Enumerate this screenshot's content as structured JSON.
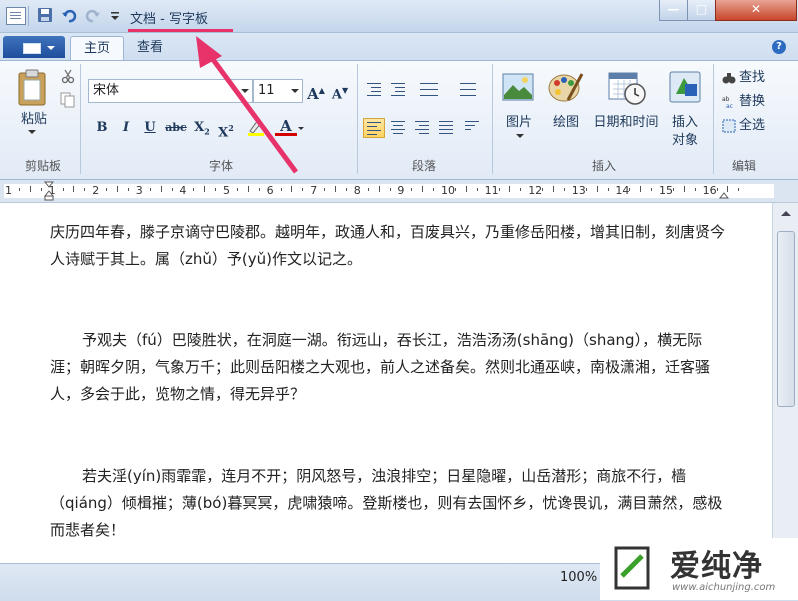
{
  "window": {
    "title": "文档 - 写字板",
    "buttons": {
      "minimize": "—",
      "maximize": "□",
      "close": "✕"
    }
  },
  "quick_access": {
    "save_icon": "save-icon",
    "undo_icon": "undo-icon",
    "redo_icon": "redo-icon",
    "customize_icon": "dropdown-icon"
  },
  "tabs": {
    "home": "主页",
    "view": "查看"
  },
  "ribbon": {
    "clipboard": {
      "paste_label": "粘贴",
      "group_label": "剪贴板"
    },
    "font": {
      "font_name": "宋体",
      "font_size": "11",
      "grow": "A",
      "shrink": "A",
      "bold": "B",
      "italic": "I",
      "underline": "U",
      "strikethrough": "abc",
      "subscript": "X",
      "superscript": "X",
      "highlight": "ab",
      "font_color": "A",
      "group_label": "字体"
    },
    "paragraph": {
      "group_label": "段落"
    },
    "insert": {
      "picture_label": "图片",
      "paint_label": "绘图",
      "datetime_label": "日期和时间",
      "object_label_1": "插入",
      "object_label_2": "对象",
      "group_label": "插入"
    },
    "editing": {
      "find_label": "查找",
      "replace_label": "替换",
      "select_all_label": "全选",
      "group_label": "编辑"
    }
  },
  "ruler": {
    "numbers": [
      "1",
      "1",
      "2",
      "3",
      "4",
      "5",
      "6",
      "7",
      "8",
      "9",
      "10",
      "11",
      "12",
      "13",
      "14",
      "15",
      "16"
    ]
  },
  "document": {
    "paragraphs": [
      "庆历四年春，滕子京谪守巴陵郡。越明年，政通人和，百废具兴，乃重修岳阳楼，增其旧制，刻唐贤今人诗赋于其上。属（zhǔ）予(yǔ)作文以记之。",
      "予观夫（fú）巴陵胜状，在洞庭一湖。衔远山，吞长江，浩浩汤汤(shāng)（shang），横无际涯；朝晖夕阴，气象万千；此则岳阳楼之大观也，前人之述备矣。然则北通巫峡，南极潇湘，迁客骚人，多会于此，览物之情，得无异乎？",
      "若夫淫(yín)雨霏霏，连月不开；阴风怒号，浊浪排空；日星隐曜，山岳潜形；商旅不行，樯（qiáng）倾楫摧；薄(bó)暮冥冥，虎啸猿啼。登斯楼也，则有去国怀乡，忧谗畏讥，满目萧然，感极而悲者矣！"
    ]
  },
  "status": {
    "zoom": "100%"
  },
  "watermark": {
    "text": "爱纯净",
    "url": "www.aichunjing.com"
  },
  "colors": {
    "accent_arrow": "#e8336a",
    "font_color_bar": "#d40000",
    "highlight_bar": "#ffff00"
  }
}
